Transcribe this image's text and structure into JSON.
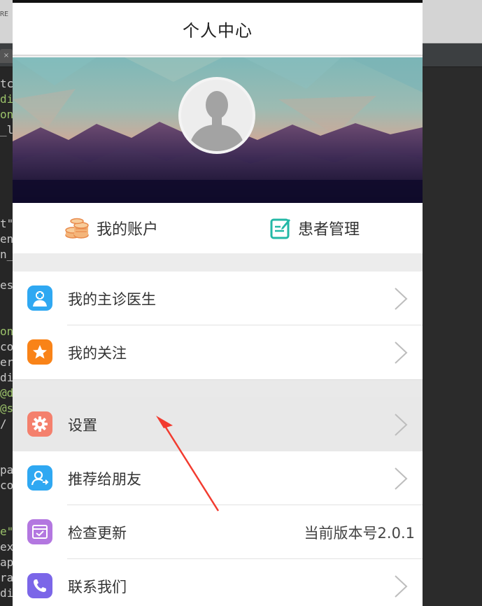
{
  "header": {
    "title": "个人中心"
  },
  "profile": {
    "avatar_icon": "user-avatar-placeholder"
  },
  "quick_actions": [
    {
      "label": "我的账户",
      "icon": "coins-icon",
      "color": "#f0a35a"
    },
    {
      "label": "患者管理",
      "icon": "edit-note-icon",
      "color": "#23b8a6"
    }
  ],
  "menu_group_1": [
    {
      "label": "我的主诊医生",
      "icon": "doctor-icon",
      "icon_color": "#2fa8f2"
    },
    {
      "label": "我的关注",
      "icon": "star-icon",
      "icon_color": "#f98318"
    }
  ],
  "menu_group_2": [
    {
      "label": "设置",
      "icon": "gear-icon",
      "icon_color": "#f4806d"
    },
    {
      "label": "推荐给朋友",
      "icon": "user-share-icon",
      "icon_color": "#2fa8f2"
    },
    {
      "label": "检查更新",
      "icon": "update-icon",
      "icon_color": "#b377e0",
      "value": "当前版本号2.0.1"
    },
    {
      "label": "联系我们",
      "icon": "phone-icon",
      "icon_color": "#7b66e8"
    }
  ],
  "annotation": {
    "arrow_color": "#f23b2f"
  },
  "background_editor": {
    "topbar_text": "RE",
    "code_fragments": [
      "tc",
      "di",
      "on",
      "_l",
      "t\"",
      "en",
      "n_",
      "es",
      "on",
      "co",
      "er",
      "di",
      "@d",
      "@s",
      " /",
      "pa",
      "co",
      "e\"",
      "ex",
      "ap",
      "ra",
      "di"
    ]
  }
}
